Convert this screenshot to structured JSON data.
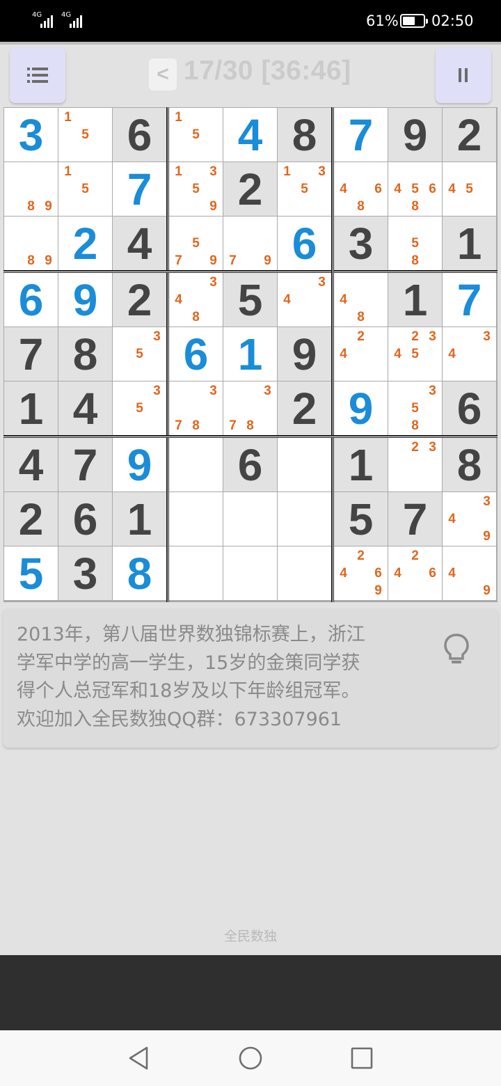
{
  "status_bar": {
    "network_1": "4G",
    "network_2": "4G",
    "battery_percent": "61%",
    "battery_level": 0.61,
    "time": "02:50"
  },
  "app_bar": {
    "menu_icon": "list-icon",
    "back_label": "<",
    "progress_title": "17/30 [36:46]",
    "pause_icon": "pause-icon"
  },
  "grid": {
    "givens": [
      [
        0,
        0,
        0,
        0,
        0,
        0,
        0,
        0,
        0
      ],
      [
        0,
        0,
        0,
        0,
        0,
        0,
        0,
        0,
        0
      ],
      [
        0,
        0,
        0,
        0,
        0,
        0,
        0,
        0,
        0
      ],
      [
        0,
        0,
        0,
        0,
        0,
        0,
        0,
        0,
        0
      ],
      [
        0,
        0,
        0,
        0,
        0,
        0,
        0,
        0,
        0
      ],
      [
        0,
        0,
        0,
        0,
        0,
        0,
        0,
        0,
        0
      ],
      [
        0,
        0,
        0,
        0,
        0,
        0,
        0,
        0,
        0
      ],
      [
        0,
        0,
        0,
        0,
        0,
        0,
        0,
        0,
        0
      ],
      [
        0,
        0,
        0,
        0,
        0,
        0,
        0,
        0,
        0
      ]
    ],
    "cells": [
      [
        "3",
        "1 5",
        "6",
        "1 5",
        "4",
        "8",
        "7",
        "9",
        "2"
      ],
      [
        "8 9",
        "1 5",
        "7",
        "1 3 5 9",
        "2",
        "1 3 5",
        "4 6 8",
        "4 5 6 8",
        "4 5"
      ],
      [
        "8 9",
        "2",
        "4",
        "5 7 9",
        "7 9",
        "6",
        "3",
        "5 8",
        "1"
      ],
      [
        "6",
        "9",
        "2",
        "3 4 8",
        "5",
        "3 4",
        "4 8",
        "1",
        "7"
      ],
      [
        "7",
        "8",
        "3 5",
        "6",
        "1",
        "9",
        "2 4",
        "2 3 4 5",
        "3 4"
      ],
      [
        "1",
        "4",
        "3 5",
        "3 7 8",
        "3 7 8",
        "2",
        "9",
        "3 5 8",
        "6"
      ],
      [
        "4",
        "7",
        "9",
        "",
        "6",
        "",
        "1",
        "2 3",
        "8"
      ],
      [
        "2",
        "6",
        "1",
        "",
        "",
        "",
        "5",
        "7",
        "3 4 9"
      ],
      [
        "5",
        "3",
        "8",
        "",
        "",
        "",
        "2 4 6 9",
        "2 4 6",
        "4 9"
      ]
    ],
    "given_mask": [
      [
        0,
        0,
        1,
        0,
        0,
        1,
        0,
        1,
        1
      ],
      [
        0,
        0,
        0,
        0,
        1,
        0,
        0,
        0,
        0
      ],
      [
        0,
        0,
        1,
        0,
        0,
        0,
        1,
        0,
        1
      ],
      [
        0,
        0,
        1,
        0,
        1,
        0,
        0,
        1,
        0
      ],
      [
        1,
        1,
        0,
        0,
        0,
        1,
        0,
        0,
        0
      ],
      [
        1,
        1,
        0,
        0,
        0,
        1,
        0,
        0,
        1
      ],
      [
        1,
        1,
        0,
        0,
        1,
        0,
        1,
        0,
        1
      ],
      [
        1,
        1,
        1,
        0,
        0,
        0,
        1,
        1,
        0
      ],
      [
        0,
        1,
        0,
        0,
        0,
        0,
        0,
        0,
        0
      ]
    ],
    "user_mask": [
      [
        1,
        0,
        0,
        0,
        1,
        0,
        1,
        0,
        0
      ],
      [
        0,
        0,
        1,
        0,
        0,
        0,
        0,
        0,
        0
      ],
      [
        0,
        1,
        0,
        0,
        0,
        1,
        0,
        0,
        0
      ],
      [
        1,
        1,
        0,
        0,
        0,
        0,
        0,
        0,
        1
      ],
      [
        0,
        0,
        0,
        1,
        1,
        0,
        0,
        0,
        0
      ],
      [
        0,
        0,
        0,
        0,
        0,
        0,
        1,
        0,
        0
      ],
      [
        0,
        0,
        1,
        0,
        0,
        0,
        0,
        0,
        0
      ],
      [
        0,
        0,
        0,
        0,
        0,
        0,
        0,
        0,
        0
      ],
      [
        1,
        0,
        1,
        0,
        0,
        0,
        0,
        0,
        0
      ]
    ],
    "colors": {
      "given": "#444444",
      "user": "#1a8cd8",
      "note": "#e0661d",
      "given_bg": "#e2e2e2"
    }
  },
  "tip": {
    "lines": [
      "2013年，第八届世界数独锦标赛上，浙江",
      "学军中学的高一学生，15岁的金策同学获",
      "得个人总冠军和18岁及以下年龄组冠军。",
      "欢迎加入全民数独QQ群：673307961"
    ],
    "hint_icon": "lightbulb-icon"
  },
  "footer": {
    "label": "全民数独"
  },
  "nav": {
    "back": "back-triangle-icon",
    "home": "home-circle-icon",
    "recents": "recents-square-icon"
  }
}
